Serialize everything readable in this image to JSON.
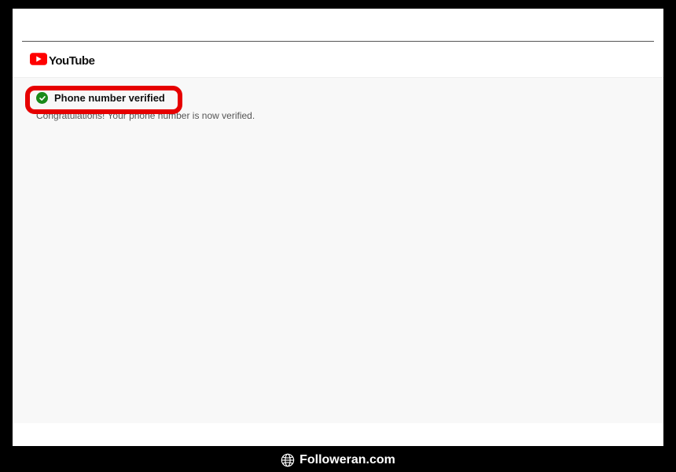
{
  "header": {
    "brand_text": "YouTube"
  },
  "content": {
    "verified_title": "Phone number verified",
    "verified_message": "Congratulations! Your phone number is now verified."
  },
  "footer": {
    "brand": "Followeran.com"
  }
}
